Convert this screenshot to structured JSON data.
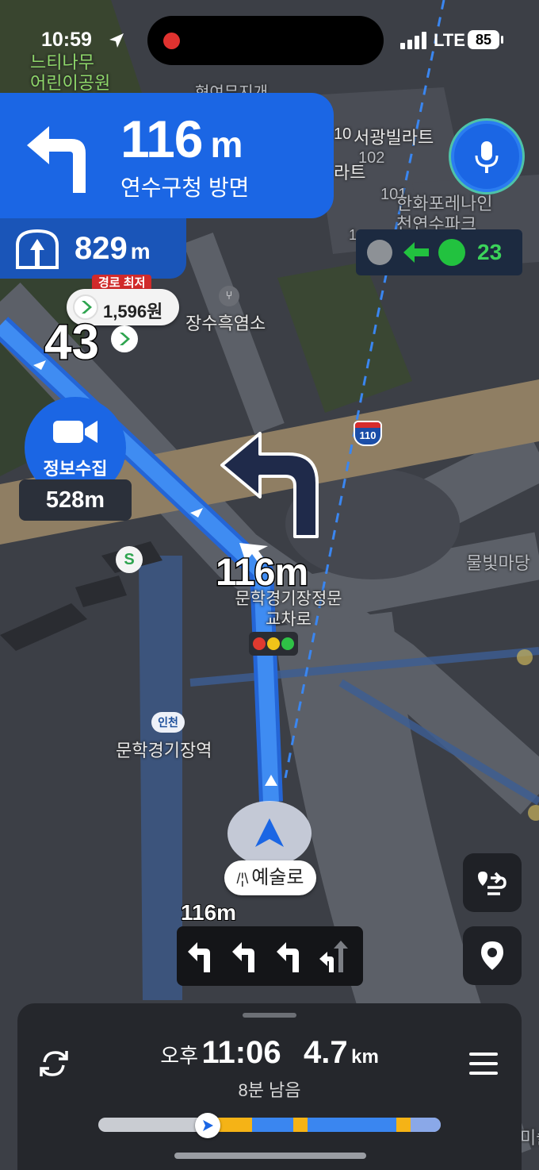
{
  "status_bar": {
    "time": "10:59",
    "network": "LTE",
    "battery": "85"
  },
  "turn": {
    "distance": "116",
    "unit": "m",
    "direction": "연수구청 방면",
    "icon": "turn-left-arrow-icon"
  },
  "tunnel": {
    "distance": "829",
    "unit": "m",
    "icon": "tunnel-icon"
  },
  "mic": {
    "icon": "microphone-icon"
  },
  "traffic_signal": {
    "countdown": "23",
    "state": "green-left-arrow"
  },
  "gas_station": {
    "tag": "경로 최저",
    "price": "1,596원"
  },
  "speed_limit": "43",
  "camera": {
    "label": "정보수집",
    "distance": "528m",
    "icon": "video-camera-icon"
  },
  "turn_distance_map": "116m",
  "map_labels": {
    "park": "느티나무\n어린이공원",
    "cut_top": "현여무지개",
    "villa1": "서광빌라트",
    "num10": "10",
    "villa2": "라트",
    "num102": "102",
    "num101": "101",
    "apt": "한화포레나인\n천연수파크",
    "num1": "1",
    "restaurant": "장수흑염소",
    "highway": "110",
    "plaza": "물빛마당",
    "intersection": "문학경기장정문\n교차로",
    "station": "문학경기장역",
    "station_badge": "인천",
    "edge": "미술"
  },
  "current_road": "예술로",
  "lane_guide": {
    "distance": "116m",
    "lanes": [
      "left",
      "left",
      "left",
      "left-straight"
    ]
  },
  "eta": {
    "ampm": "오후",
    "time": "11:06",
    "distance": "4.7",
    "unit": "km",
    "remaining": "8분 남음"
  },
  "progress": {
    "traveled_fraction": 0.32
  },
  "colors": {
    "accent": "#1b66e4",
    "route": "#3a86f0",
    "traffic_slow": "#f5b316",
    "signal_green": "#22c23f"
  }
}
